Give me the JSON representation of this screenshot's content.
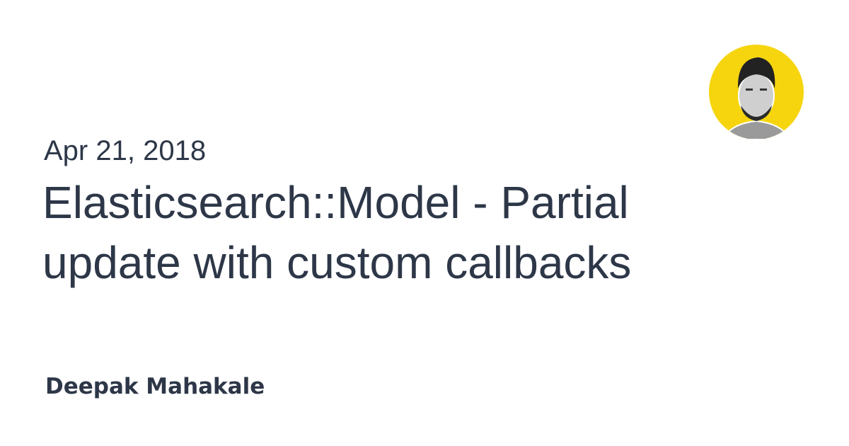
{
  "post": {
    "date": "Apr 21, 2018",
    "title": "Elasticsearch::Model - Partial update with custom callbacks",
    "author": "Deepak Mahakale"
  },
  "colors": {
    "text": "#2d3748",
    "avatar_bg": "#f6d50f"
  }
}
